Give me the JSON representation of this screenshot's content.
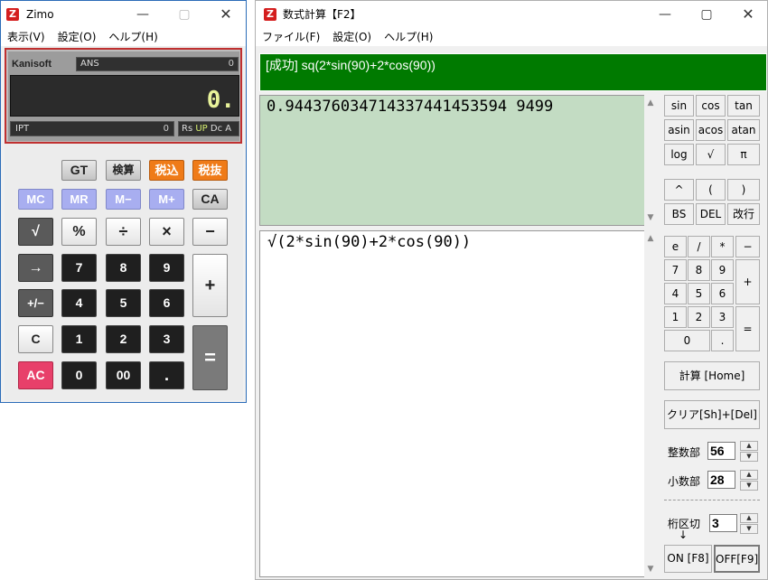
{
  "zimo": {
    "title": "Zimo",
    "icon": "Z",
    "menu": [
      "表示(V)",
      "設定(O)",
      "ヘルプ(H)"
    ],
    "brand": "Kanisoft",
    "ans_label": "ANS",
    "ans_value": "0",
    "display_value": "0.",
    "ipt_label": "IPT",
    "ipt_value": "0",
    "mode_rs": "Rs",
    "mode_up": "UP",
    "mode_dc": "Dc",
    "mode_a": "A",
    "keys": {
      "gt": "GT",
      "kensan": "検算",
      "zeikomi": "税込",
      "zeinuki": "税抜",
      "mc": "MC",
      "mr": "MR",
      "mminus": "M−",
      "mplus": "M+",
      "ca": "CA",
      "sqrt": "√",
      "percent": "%",
      "divide": "÷",
      "multiply": "×",
      "minus": "−",
      "arrow": "→",
      "n7": "7",
      "n8": "8",
      "n9": "9",
      "plus": "+",
      "sign": "+/−",
      "n4": "4",
      "n5": "5",
      "n6": "6",
      "clear": "C",
      "n1": "1",
      "n2": "2",
      "n3": "3",
      "equals": "=",
      "ac": "AC",
      "n0": "0",
      "n00": "00",
      "dot": "."
    }
  },
  "formula": {
    "title": "数式計算【F2】",
    "icon": "Z",
    "menu": [
      "ファイル(F)",
      "設定(O)",
      "ヘルプ(H)"
    ],
    "status": "[成功] sq(2*sin(90)+2*cos(90))",
    "result": "0.944376034714337441453594 9499",
    "input": "√(2*sin(90)+2*cos(90))",
    "func_keys": [
      "sin",
      "cos",
      "tan",
      "asin",
      "acos",
      "atan",
      "log",
      "√",
      "π"
    ],
    "op_keys": [
      "^",
      "(",
      ")",
      "BS",
      "DEL",
      "改行"
    ],
    "num_keys": {
      "e": "e",
      "slash": "/",
      "star": "*",
      "minus": "−",
      "n7": "7",
      "n8": "8",
      "n9": "9",
      "plus": "+",
      "n4": "4",
      "n5": "5",
      "n6": "6",
      "n1": "1",
      "n2": "2",
      "n3": "3",
      "equals": "=",
      "n0": "0",
      "dot": "."
    },
    "calc_button": "計算 [Home]",
    "clear_button": "クリア[Sh]+[Del]",
    "integer_label": "整数部",
    "integer_value": "56",
    "decimal_label": "小数部",
    "decimal_value": "28",
    "group_label": "桁区切",
    "group_arrow": "↓",
    "group_value": "3",
    "on_button": "ON [F8]",
    "off_button": "OFF[F9]"
  }
}
